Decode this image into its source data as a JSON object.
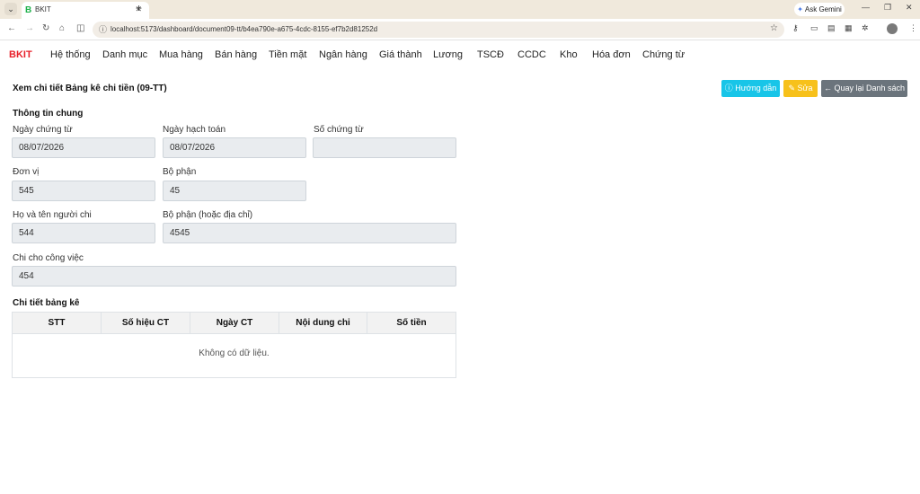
{
  "browser": {
    "tab_title": "BKIT",
    "tab_favicon": "B",
    "gemini_label": "Ask Gemini",
    "url": "localhost:5173/dashboard/document09-tt/b4ea790e-a675-4cdc-8155-ef7b2d81252d"
  },
  "nav": {
    "brand": "BKIT",
    "items": [
      "Hệ thống",
      "Danh mục",
      "Mua hàng",
      "Bán hàng",
      "Tiền mặt",
      "Ngân hàng",
      "Giá thành",
      "Lương",
      "TSCĐ",
      "CCDC",
      "Kho",
      "Hóa đơn",
      "Chứng từ"
    ]
  },
  "page": {
    "title": "Xem chi tiết Bảng kê chi tiền (09-TT)",
    "help_label": "Hướng dẫn",
    "edit_label": "Sửa",
    "back_label": "Quay lại Danh sách"
  },
  "general": {
    "section_title": "Thông tin chung",
    "ngay_chung_tu": {
      "label": "Ngày chứng từ",
      "value": "08/07/2026"
    },
    "ngay_hach_toan": {
      "label": "Ngày hạch toán",
      "value": "08/07/2026"
    },
    "so_chung_tu": {
      "label": "Số chứng từ",
      "value": ""
    },
    "don_vi": {
      "label": "Đơn vị",
      "value": "545"
    },
    "bo_phan": {
      "label": "Bộ phận",
      "value": "45"
    },
    "nguoi_chi": {
      "label": "Họ và tên người chi",
      "value": "544"
    },
    "bo_phan_dia_chi": {
      "label": "Bộ phận (hoặc địa chỉ)",
      "value": "4545"
    },
    "chi_cho_cong_viec": {
      "label": "Chi cho công việc",
      "value": "454"
    }
  },
  "detail": {
    "section_title": "Chi tiết bảng kê",
    "columns": [
      "STT",
      "Số hiệu CT",
      "Ngày CT",
      "Nội dung chi",
      "Số tiền"
    ],
    "empty_text": "Không có dữ liệu."
  }
}
